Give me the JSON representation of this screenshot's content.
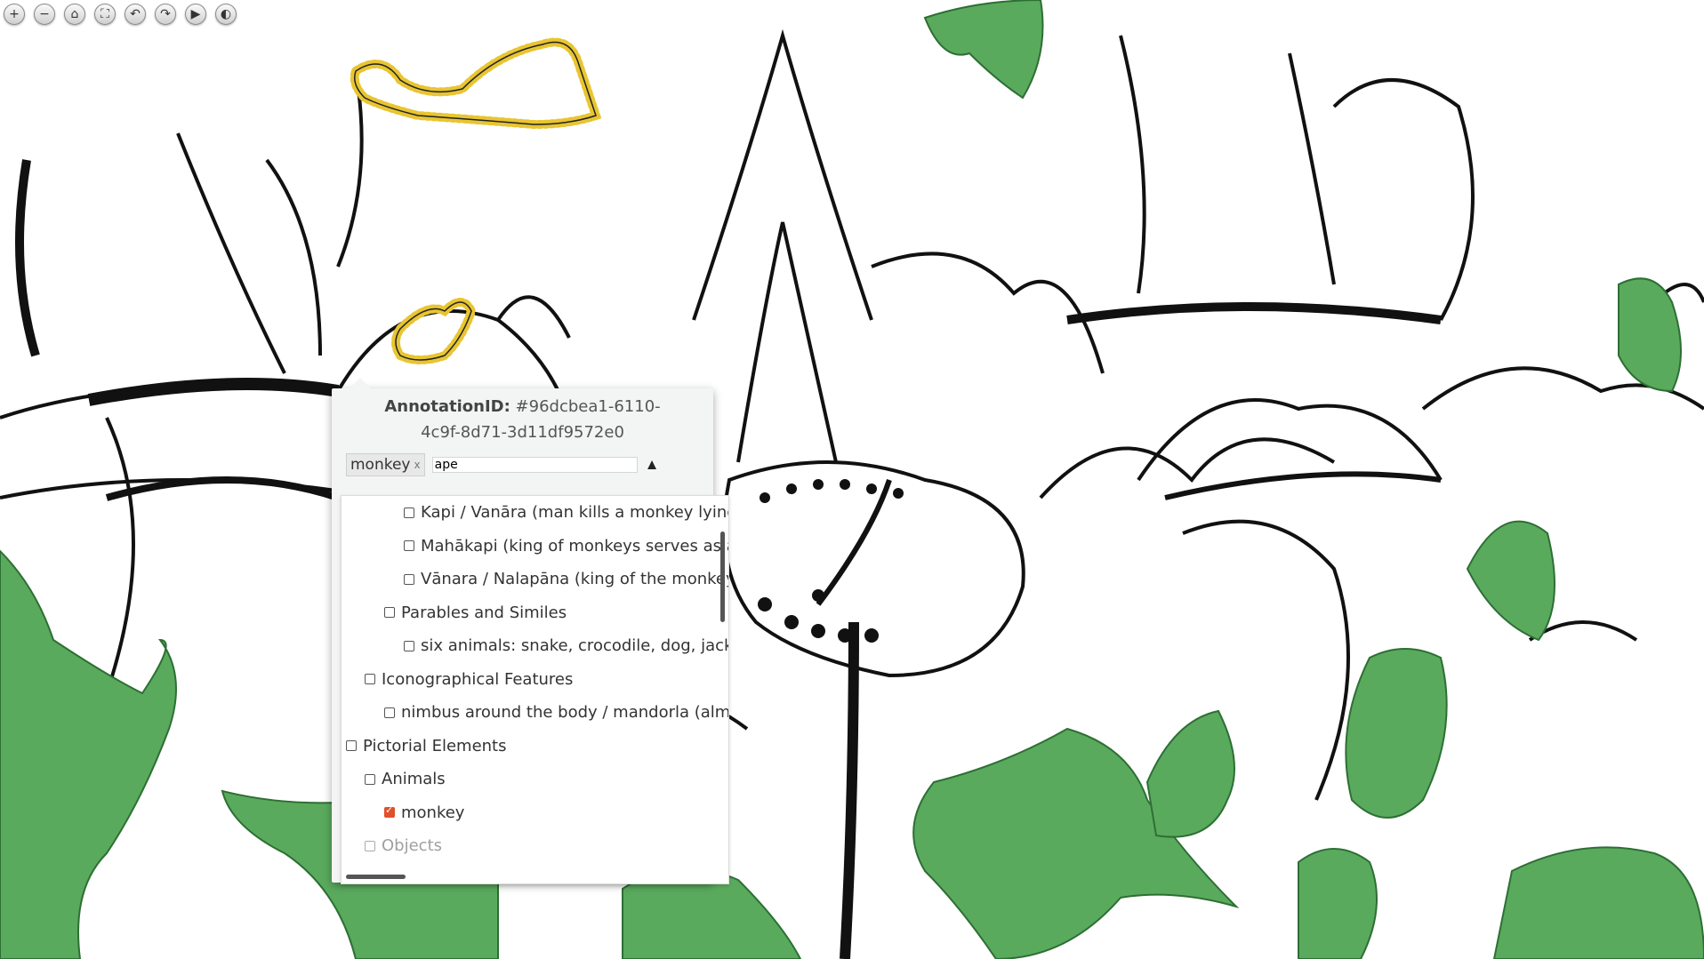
{
  "toolbar": {
    "buttons": [
      {
        "name": "zoom-in-icon",
        "glyph": "+"
      },
      {
        "name": "zoom-out-icon",
        "glyph": "−"
      },
      {
        "name": "home-icon",
        "glyph": "⌂"
      },
      {
        "name": "fullscreen-icon",
        "glyph": "⛶"
      },
      {
        "name": "rotate-left-icon",
        "glyph": "↶"
      },
      {
        "name": "rotate-right-icon",
        "glyph": "↷"
      },
      {
        "name": "play-icon",
        "glyph": "▶"
      },
      {
        "name": "contrast-icon",
        "glyph": "◐"
      }
    ]
  },
  "popup": {
    "id_label": "AnnotationID:",
    "id_value": "#96dcbea1-6110-4c9f-8d71-3d11df9572e0",
    "tags": [
      {
        "label": "monkey",
        "remove": "x"
      }
    ],
    "input_value": "ape",
    "toggle_glyph": "▲"
  },
  "dropdown": {
    "items": [
      {
        "label": "Kapi / Vanāra (man kills a monkey lying on",
        "level": 3,
        "checked": false
      },
      {
        "label": "Mahākapi (king of monkeys serves as a bri",
        "level": 3,
        "checked": false
      },
      {
        "label": "Vānara / Nalapāna (king of the monkeys a",
        "level": 3,
        "checked": false
      },
      {
        "label": "Parables and Similes",
        "level": 2,
        "checked": false
      },
      {
        "label": "six animals: snake, crocodile, dog, jackal, b",
        "level": 3,
        "checked": false
      },
      {
        "label": "Iconographical Features",
        "level": 1,
        "checked": false
      },
      {
        "label": "nimbus around the body / mandorla (almond",
        "level": 2,
        "checked": false
      },
      {
        "label": "Pictorial Elements",
        "level": 0,
        "checked": false
      },
      {
        "label": "Animals",
        "level": 1,
        "checked": false
      },
      {
        "label": "monkey",
        "level": 2,
        "checked": true
      },
      {
        "label": "Objects",
        "level": 1,
        "checked": false,
        "muted": true
      }
    ]
  },
  "colors": {
    "annotation_fill": "#5aaa5e",
    "annotation_stroke": "#2d6f34",
    "selection_stroke": "#e8c531",
    "checkbox_checked": "#e0502b"
  }
}
